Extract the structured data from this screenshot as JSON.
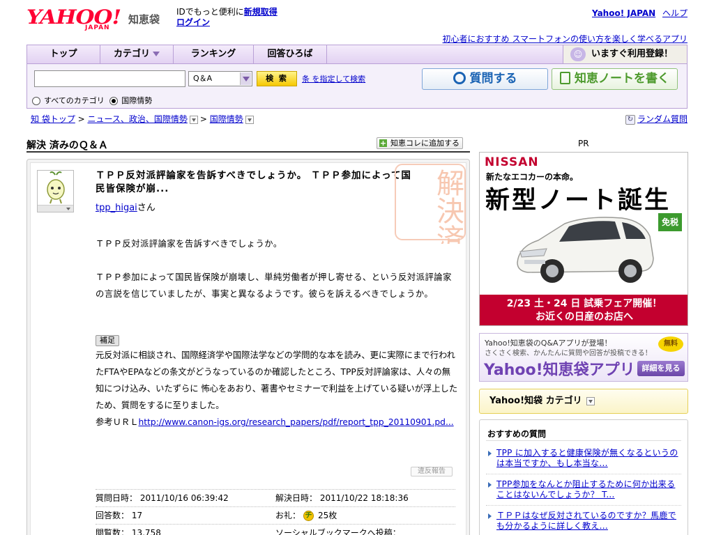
{
  "header": {
    "logo_text": "YAHOO!",
    "logo_sub": "JAPAN",
    "service_name": "知恵袋",
    "id_promo": "IDでもっと便利に",
    "signup_link": "新規取得",
    "login_link": "ログイン",
    "top_links": [
      "Yahoo! JAPAN",
      "ヘルプ"
    ],
    "promo_link": "初心者におすすめ スマートフォンの使い方を楽しく学べるアプリ"
  },
  "nav": {
    "tabs": [
      "トップ",
      "カテゴリ",
      "ランキング",
      "回答ひろば"
    ],
    "register": "いますぐ利用登録！"
  },
  "search": {
    "placeholder": "",
    "select_value": "Q＆A",
    "button": "検 索",
    "advanced": "条 を指定して検索",
    "scope_all": "すべてのカテゴリ",
    "scope_current": "国際情勢",
    "ask_button": "質問する",
    "note_button": "知恵ノートを書く"
  },
  "breadcrumb": {
    "items": [
      "知 袋トップ",
      "ニュース、政治、国際情勢",
      "国際情勢"
    ],
    "random": "ランダム質問"
  },
  "main": {
    "section_title": "解決 済みのＱ＆Ａ",
    "add_collection": "知恵コレに追加する",
    "stamp_text": "解決済み",
    "question": {
      "title": "ＴＰＰ反対派評論家を告訴すべきでしょうか。 ＴＰＰ参加によって国民皆保険が崩...",
      "user": "tpp_higai",
      "user_suffix": "さん",
      "body": [
        "ＴＰＰ反対派評論家を告訴すべきでしょうか。",
        "",
        "ＴＰＰ参加によって国民皆保険が崩壊し、単純労働者が押し寄せる、という反対派評論家の言説を信じていましたが、事実と異なるようです。彼らを訴えるべきでしょうか。"
      ],
      "supplement_label": "補足",
      "supplement": "元反対派に相談され、国際経済学や国際法学などの学問的な本を読み、更に実際にまで行われたFTAやEPAなどの条文がどうなっているのか確認したところ、TPP反対評論家は、人々の無知につけ込み、いたずらに 怖心をあおり、著書やセミナーで利益を上げている疑いが浮上したため、質問をするに至りました。",
      "ref_label": "参考ＵＲＬ",
      "ref_url": "http://www.canon-igs.org/research_papers/pdf/report_tpp_20110901.pd...",
      "report": "違反報告"
    },
    "meta": {
      "asked_label": "質問日時：",
      "asked_value": "2011/10/16 06:39:42",
      "resolved_label": "解決日時：",
      "resolved_value": "2011/10/22 18:18:36",
      "answers_label": "回答数：",
      "answers_value": "17",
      "reward_label": "お礼：",
      "reward_value": "25枚",
      "views_label": "閲覧数：",
      "views_value": "13,758",
      "social_label": "ソーシャルブックマークへ投稿："
    }
  },
  "sidebar": {
    "pr_label": "PR",
    "nissan_ad": {
      "brand": "NISSAN",
      "tagline": "新たなエコカーの本命。",
      "headline": "新型ノート誕生",
      "badge": "免税",
      "footer_line1": "2/23 土・24 日 試乗フェア開催！",
      "footer_line2": "お近くの日産のお店へ"
    },
    "app_ad": {
      "line1": "Yahoo!知恵袋のQ&Aアプリが登場！",
      "line2": "さくさく検索、かんたんに質問や回答が投稿できる！",
      "title": "Yahoo!知恵袋アプリ",
      "free": "無料",
      "details": "詳細を見る"
    },
    "category_box": "Yahoo!知袋 カテゴリ",
    "recommended": {
      "title": "おすすめの質問",
      "items": [
        "TPP に加入すると健康保険が無くなるというのは本当ですか、もし本当な...",
        "TPP参加をなんとか阻止するために何か出来ることはないんでしょうか？ T...",
        "ＴＰＰはなぜ反対されているのですか？馬鹿でも分かるように詳しく教え..."
      ]
    }
  }
}
